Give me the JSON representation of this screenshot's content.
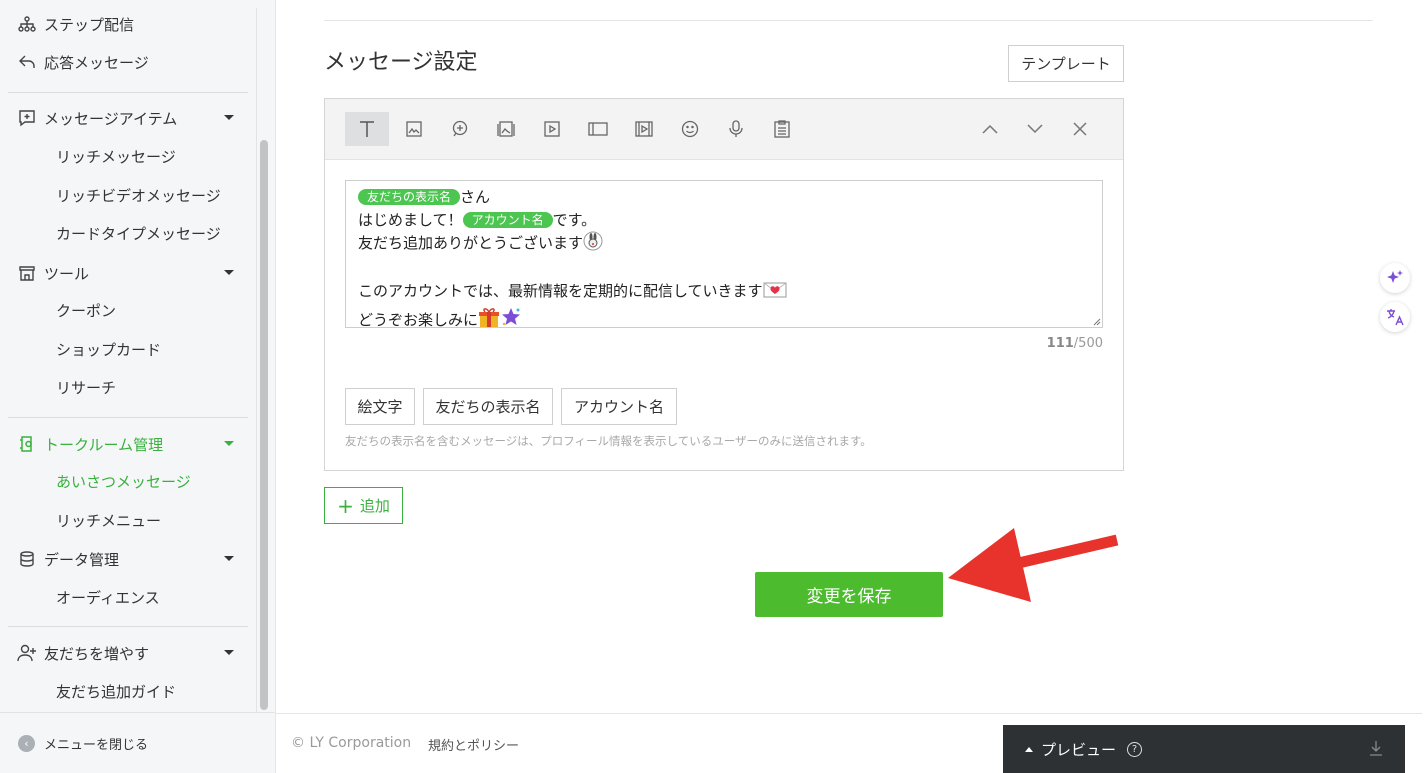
{
  "sidebar": {
    "items": [
      {
        "label": "ステップ配信",
        "icon": "step-icon"
      },
      {
        "label": "応答メッセージ",
        "icon": "reply-icon"
      },
      {
        "label": "メッセージアイテム",
        "icon": "message-item-icon"
      },
      {
        "label": "リッチメッセージ"
      },
      {
        "label": "リッチビデオメッセージ"
      },
      {
        "label": "カードタイプメッセージ"
      },
      {
        "label": "ツール",
        "icon": "shop-icon"
      },
      {
        "label": "クーポン"
      },
      {
        "label": "ショップカード"
      },
      {
        "label": "リサーチ"
      },
      {
        "label": "トークルーム管理",
        "icon": "chatroom-icon"
      },
      {
        "label": "あいさつメッセージ"
      },
      {
        "label": "リッチメニュー"
      },
      {
        "label": "データ管理",
        "icon": "database-icon"
      },
      {
        "label": "オーディエンス"
      },
      {
        "label": "友だちを増やす",
        "icon": "add-friend-icon"
      },
      {
        "label": "友だち追加ガイド"
      }
    ],
    "close_menu": "メニューを閉じる"
  },
  "main": {
    "title": "メッセージ設定",
    "template_button": "テンプレート",
    "toolbar_icons": [
      "text-icon",
      "image-icon",
      "stamp-icon",
      "rich-message-icon",
      "video-icon",
      "coupon-icon",
      "rich-video-icon",
      "emoji-icon",
      "voice-icon",
      "survey-icon"
    ],
    "editor": {
      "tag_friend_name": "友だちの表示名",
      "tag_account_name": "アカウント名",
      "line1_suffix": "さん",
      "line2_prefix": "はじめまして！",
      "line2_suffix": "です。",
      "line3": "友だち追加ありがとうございます",
      "line4": "このアカウントでは、最新情報を定期的に配信していきます",
      "line5": "どうぞお楽しみに",
      "count": "111",
      "max": "/500"
    },
    "insert_buttons": [
      "絵文字",
      "友だちの表示名",
      "アカウント名"
    ],
    "note": "友だちの表示名を含むメッセージは、プロフィール情報を表示しているユーザーのみに送信されます。",
    "add_button": "追加",
    "save_button": "変更を保存"
  },
  "footer": {
    "copyright": "© LY Corporation",
    "policy": "規約とポリシー"
  },
  "preview": {
    "label": "プレビュー"
  },
  "colors": {
    "accent": "#3ab03e",
    "save": "#4cbb2e",
    "tag": "#4cc551",
    "arrow": "#e8322c"
  }
}
